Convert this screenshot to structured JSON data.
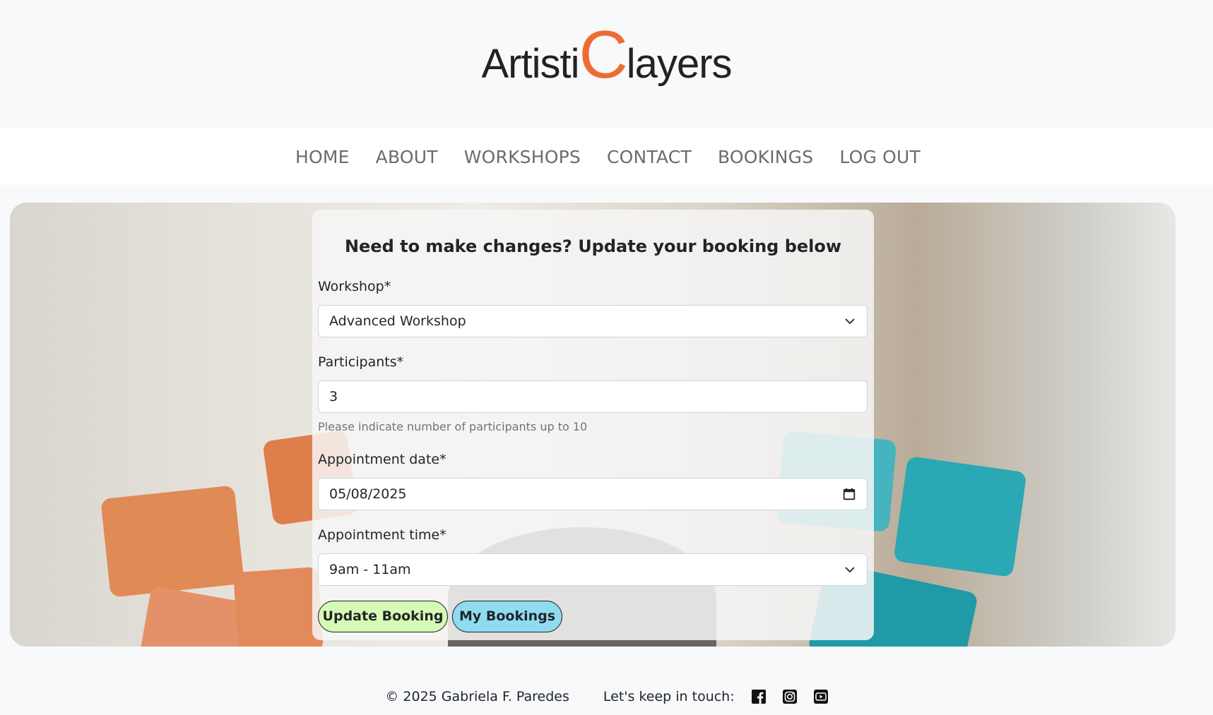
{
  "logo": {
    "part1": "Artisti",
    "big": "C",
    "part2": "layers"
  },
  "nav": {
    "items": [
      "HOME",
      "ABOUT",
      "WORKSHOPS",
      "CONTACT",
      "BOOKINGS",
      "LOG OUT"
    ]
  },
  "form": {
    "title": "Need to make changes? Update your booking below",
    "workshop_label": "Workshop*",
    "workshop_value": "Advanced Workshop",
    "participants_label": "Participants*",
    "participants_value": "3",
    "participants_help": "Please indicate number of participants up to 10",
    "date_label": "Appointment date*",
    "date_value": "05/08/2025",
    "time_label": "Appointment time*",
    "time_value": "9am - 11am",
    "update_button": "Update Booking",
    "my_bookings_button": "My Bookings"
  },
  "footer": {
    "copyright": "© 2025 Gabriela F. Paredes",
    "keep_in_touch": "Let's keep in touch:",
    "icons": [
      "facebook-icon",
      "instagram-icon",
      "youtube-icon"
    ]
  },
  "colors": {
    "accent": "#f06b34",
    "update_button_bg": "#d6fbb7",
    "my_bookings_button_bg": "#8fdcf0"
  }
}
